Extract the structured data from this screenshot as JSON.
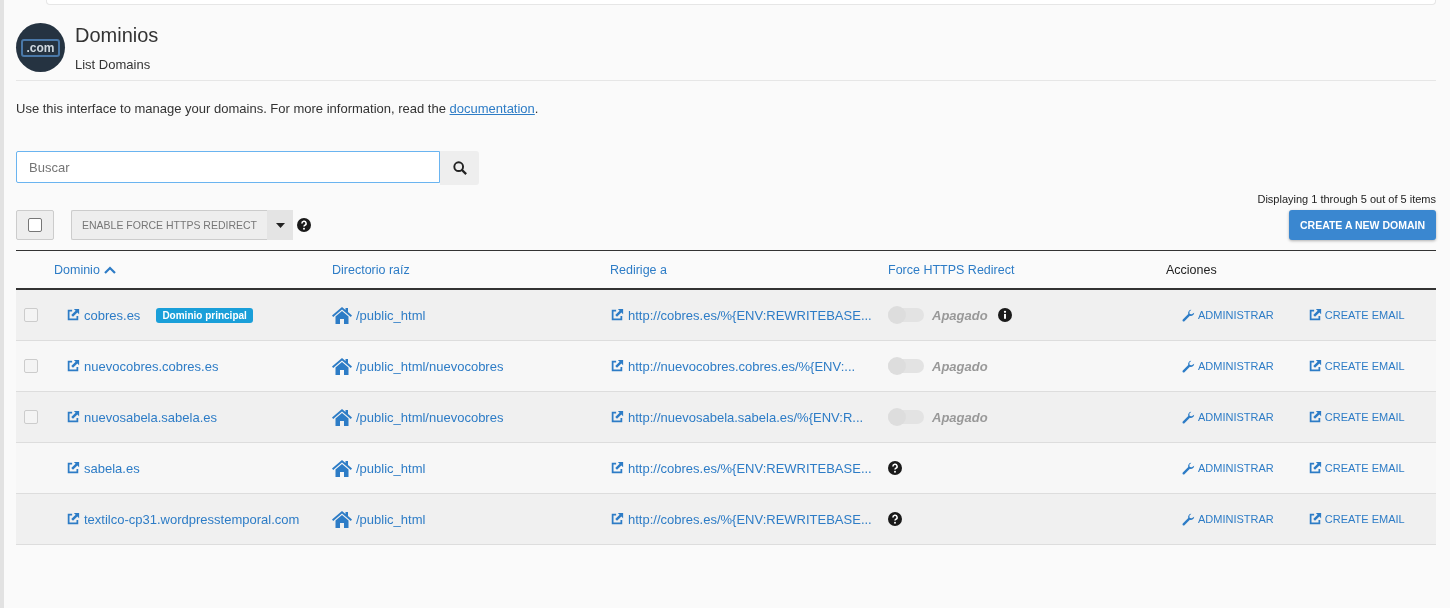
{
  "header": {
    "logo_text": ".com",
    "title": "Dominios",
    "subtitle": "List Domains"
  },
  "intro": {
    "text": "Use this interface to manage your domains. For more information, read the ",
    "link": "documentation",
    "after": "."
  },
  "search": {
    "placeholder": "Buscar"
  },
  "pager_text": "Displaying 1 through 5 out of 5 items",
  "toolbar": {
    "select_all_checked": false,
    "bulk_action": "ENABLE FORCE HTTPS REDIRECT",
    "create_button": "CREATE A NEW DOMAIN"
  },
  "table": {
    "columns": [
      {
        "label": "Dominio",
        "kind": "link",
        "sorted": true
      },
      {
        "label": "Directorio raíz",
        "kind": "link"
      },
      {
        "label": "Redirige a",
        "kind": "link"
      },
      {
        "label": "Force HTTPS Redirect",
        "kind": "link"
      },
      {
        "label": "Acciones",
        "kind": "plain"
      }
    ],
    "rows": [
      {
        "checked": false,
        "domain": "cobres.es",
        "badge": "Dominio principal",
        "root": "/public_html",
        "redirect": "http://cobres.es/%{ENV:REWRITEBASE...",
        "https": {
          "kind": "toggle",
          "on": false,
          "label": "Apagado",
          "info": true
        },
        "actions": [
          "ADMINISTRAR",
          "CREATE EMAIL"
        ]
      },
      {
        "checked": false,
        "domain": "nuevocobres.cobres.es",
        "root": "/public_html/nuevocobres",
        "redirect": "http://nuevocobres.cobres.es/%{ENV:...",
        "https": {
          "kind": "toggle",
          "on": false,
          "label": "Apagado",
          "info": false
        },
        "actions": [
          "ADMINISTRAR",
          "CREATE EMAIL"
        ]
      },
      {
        "checked": false,
        "domain": "nuevosabela.sabela.es",
        "root": "/public_html/nuevocobres",
        "redirect": "http://nuevosabela.sabela.es/%{ENV:R...",
        "https": {
          "kind": "toggle",
          "on": false,
          "label": "Apagado",
          "info": false
        },
        "actions": [
          "ADMINISTRAR",
          "CREATE EMAIL"
        ]
      },
      {
        "domain": "sabela.es",
        "root": "/public_html",
        "redirect": "http://cobres.es/%{ENV:REWRITEBASE...",
        "https": {
          "kind": "help"
        },
        "actions": [
          "ADMINISTRAR",
          "CREATE EMAIL"
        ]
      },
      {
        "domain": "textilco-cp31.wordpresstemporal.com",
        "root": "/public_html",
        "redirect": "http://cobres.es/%{ENV:REWRITEBASE...",
        "https": {
          "kind": "help"
        },
        "actions": [
          "ADMINISTRAR",
          "CREATE EMAIL"
        ]
      }
    ]
  }
}
